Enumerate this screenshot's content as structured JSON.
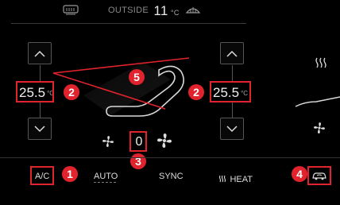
{
  "topbar": {
    "rear_defrost_icon": "rear-defrost-icon",
    "outside_label": "OUTSIDE",
    "outside_temp": "11",
    "outside_unit": "°C",
    "front_defrost_icon": "front-defrost-icon"
  },
  "driver": {
    "temperature": "25.5",
    "unit": "°C",
    "up_icon": "chevron-up-icon",
    "down_icon": "chevron-down-icon"
  },
  "passenger": {
    "temperature": "25.5",
    "unit": "°C",
    "up_icon": "chevron-up-icon",
    "down_icon": "chevron-down-icon"
  },
  "fan": {
    "speed": "0",
    "decrease_icon": "fan-small-icon",
    "increase_icon": "fan-large-icon"
  },
  "bottom_bar": {
    "ac_label": "A/C",
    "auto_label": "AUTO",
    "sync_label": "SYNC",
    "heat_label": "HEAT",
    "heat_icon": "heat-icon",
    "recirculation_icon": "car-recirculation-icon"
  },
  "annotations": {
    "badges": [
      "1",
      "2",
      "2",
      "3",
      "4",
      "5"
    ]
  },
  "colors": {
    "background": "#000000",
    "highlight": "#e0232c",
    "text": "#f0f0f0",
    "muted": "#888888"
  }
}
